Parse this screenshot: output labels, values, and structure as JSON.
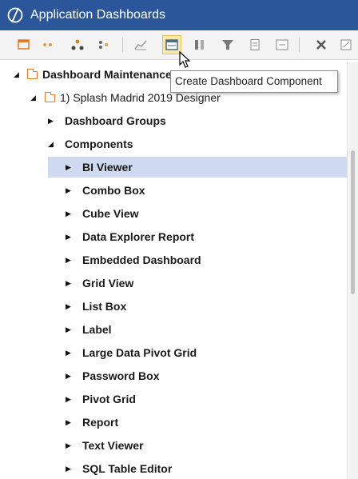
{
  "window": {
    "title": "Application Dashboards"
  },
  "toolbar": {
    "buttons": [
      "new-dashboard-icon",
      "link-icon",
      "hierarchy-icon",
      "group-icon",
      "chart-icon",
      "create-component-icon",
      "columns-icon",
      "filter-icon",
      "document-icon",
      "form-icon",
      "delete-icon",
      "copy-icon"
    ],
    "tooltip": "Create Dashboard Component",
    "colors": {
      "active_bg": "#f7e7a8",
      "accent": "#e07b2a"
    }
  },
  "tree": {
    "root": "Dashboard Maintenance",
    "profile": "1) Splash Madrid 2019 Designer",
    "groups_label": "Dashboard Groups",
    "components_label": "Components",
    "components": [
      "BI Viewer",
      "Combo Box",
      "Cube View",
      "Data Explorer Report",
      "Embedded Dashboard",
      "Grid View",
      "List Box",
      "Label",
      "Large Data Pivot Grid",
      "Password Box",
      "Pivot Grid",
      "Report",
      "Text Viewer",
      "SQL Table Editor"
    ],
    "selected": "BI Viewer"
  },
  "colors": {
    "titlebar": "#2b579a",
    "selection": "#cfdaf1"
  }
}
